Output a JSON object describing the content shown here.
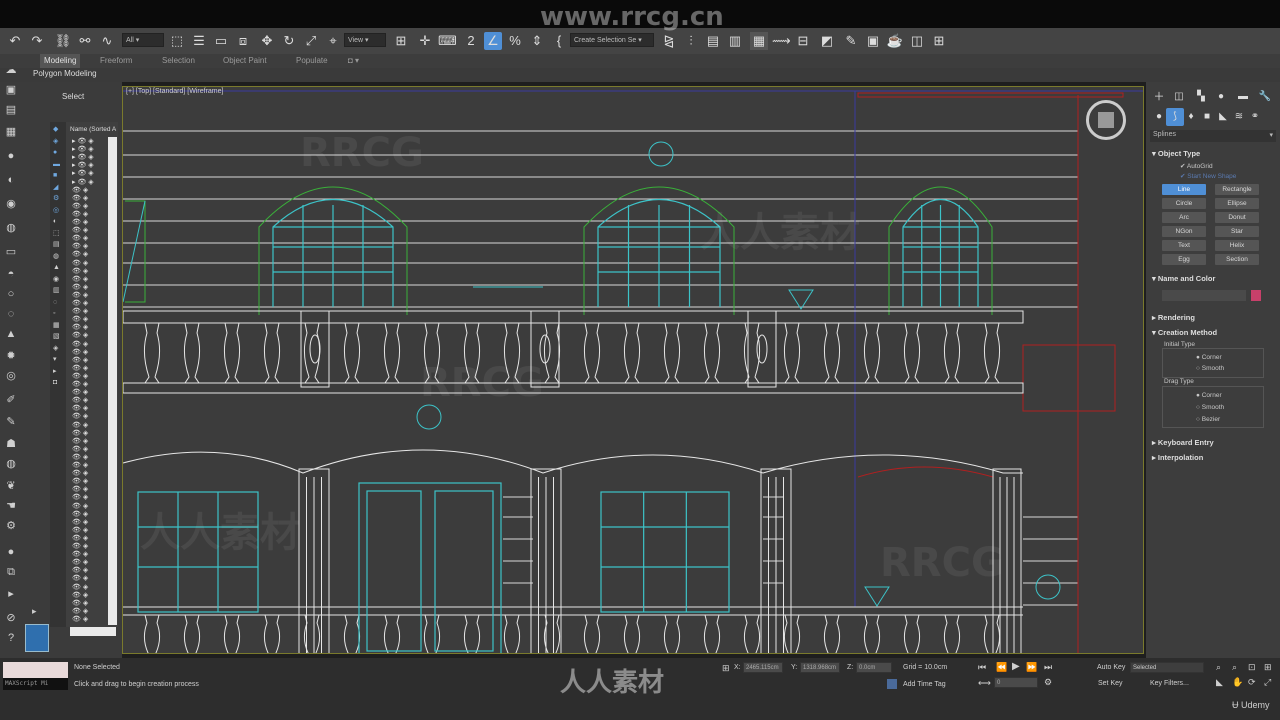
{
  "toolbar": {
    "selection_filter": "All",
    "view_dropdown": "View",
    "selection_set": "Create Selection Se",
    "icons": [
      "undo-icon",
      "redo-icon",
      "link-icon",
      "unlink-icon",
      "bind-icon",
      "select-object-icon",
      "select-by-name-icon",
      "rect-region-icon",
      "window-crossing-icon",
      "move-icon",
      "rotate-icon",
      "scale-icon",
      "snap-toggle-icon",
      "angle-snap-icon",
      "percent-snap-icon",
      "spinner-snap-icon",
      "named-selection-icon",
      "mirror-icon",
      "align-icon",
      "layer-icon",
      "toggle-ribbon-icon",
      "curve-editor-icon",
      "schematic-icon",
      "material-editor-icon",
      "render-setup-icon",
      "render-frame-icon",
      "render-icon"
    ]
  },
  "watermark": {
    "top_text": "www.rrcg.cn",
    "overlay_words": [
      "RRCG",
      "人人素材"
    ]
  },
  "ribbon": {
    "tabs": [
      "Modeling",
      "Freeform",
      "Selection",
      "Object Paint",
      "Populate"
    ],
    "active_tab": "Modeling",
    "sub_label": "Polygon Modeling"
  },
  "scene_explorer": {
    "select_label": "Select",
    "column_header": "Name (Sorted A",
    "row_count": 60
  },
  "viewport": {
    "label": "[+] [Top] [Standard] [Wireframe]"
  },
  "command_panel": {
    "category": "Splines",
    "object_type": {
      "title": "Object Type",
      "autogrid": "AutoGrid",
      "start_new_shape": "Start New Shape",
      "buttons": [
        "Line",
        "Rectangle",
        "Circle",
        "Ellipse",
        "Arc",
        "Donut",
        "NGon",
        "Star",
        "Text",
        "Helix",
        "Egg",
        "Section"
      ],
      "selected": "Line"
    },
    "name_and_color": {
      "title": "Name and Color",
      "color": "#c8406a"
    },
    "rendering": {
      "title": "Rendering"
    },
    "creation_method": {
      "title": "Creation Method",
      "initial_type_label": "Initial Type",
      "initial_options": [
        "Corner",
        "Smooth"
      ],
      "initial_selected": "Corner",
      "drag_type_label": "Drag Type",
      "drag_options": [
        "Corner",
        "Smooth",
        "Bezier"
      ],
      "drag_selected": "Corner"
    },
    "keyboard_entry": {
      "title": "Keyboard Entry"
    },
    "interpolation": {
      "title": "Interpolation"
    }
  },
  "status": {
    "maxscript": "MAXScript Mi",
    "selection": "None Selected",
    "prompt": "Click and drag to begin creation process",
    "x_label": "X:",
    "x_value": "2465.115cm",
    "y_label": "Y:",
    "y_value": "1318.968cm",
    "z_label": "Z:",
    "z_value": "0.0cm",
    "grid": "Grid = 10.0cm",
    "add_time_tag": "Add Time Tag",
    "auto_key": "Auto Key",
    "selected_dropdown": "Selected",
    "set_key": "Set Key",
    "key_filters": "Key Filters...",
    "frame": "0",
    "udemy": "Udemy",
    "bottom_watermark": "人人素材"
  }
}
